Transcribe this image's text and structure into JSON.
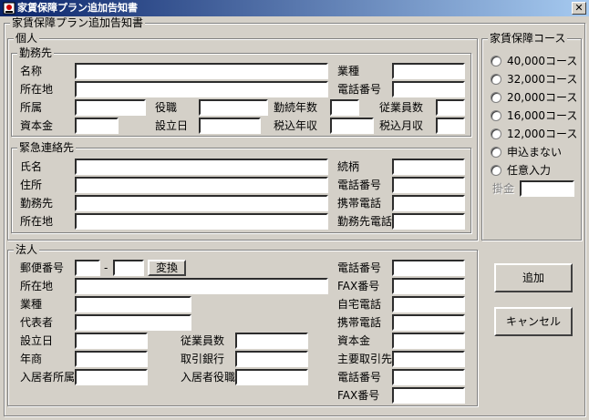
{
  "window": {
    "title": "家賃保障プラン追加告知書",
    "close_label": "✕"
  },
  "form": {
    "title": "家賃保障プラン追加告知書",
    "individual": {
      "legend": "個人",
      "employer": {
        "legend": "勤務先",
        "labels": {
          "name": "名称",
          "industry": "業種",
          "address": "所在地",
          "phone": "電話番号",
          "department": "所属",
          "position": "役職",
          "years": "勤続年数",
          "employees": "従業員数",
          "capital": "資本金",
          "established": "設立日",
          "annual_income": "税込年収",
          "monthly_income": "税込月収"
        }
      },
      "emergency": {
        "legend": "緊急連絡先",
        "labels": {
          "name": "氏名",
          "relation": "続柄",
          "address": "住所",
          "phone": "電話番号",
          "workplace": "勤務先",
          "mobile": "携帯電話",
          "work_address": "所在地",
          "work_phone": "勤務先電話"
        }
      }
    },
    "corporate": {
      "legend": "法人",
      "labels": {
        "postal": "郵便番号",
        "postal_sep": "-",
        "address": "所在地",
        "industry": "業種",
        "representative": "代表者",
        "established": "設立日",
        "revenue": "年商",
        "resident_dept": "入居者所属",
        "employees": "従業員数",
        "bank": "取引銀行",
        "resident_position": "入居者役職",
        "phone": "電話番号",
        "fax": "FAX番号",
        "home_phone": "自宅電話",
        "mobile": "携帯電話",
        "capital": "資本金",
        "main_client": "主要取引先",
        "phone2": "電話番号",
        "fax2": "FAX番号"
      },
      "convert_button": "変換"
    },
    "course": {
      "legend": "家賃保障コース",
      "options": [
        "40,000コース",
        "32,000コース",
        "20,000コース",
        "16,000コース",
        "12,000コース",
        "申込まない",
        "任意入力"
      ],
      "amount_label": "掛金"
    },
    "buttons": {
      "add": "追加",
      "cancel": "キャンセル"
    }
  }
}
